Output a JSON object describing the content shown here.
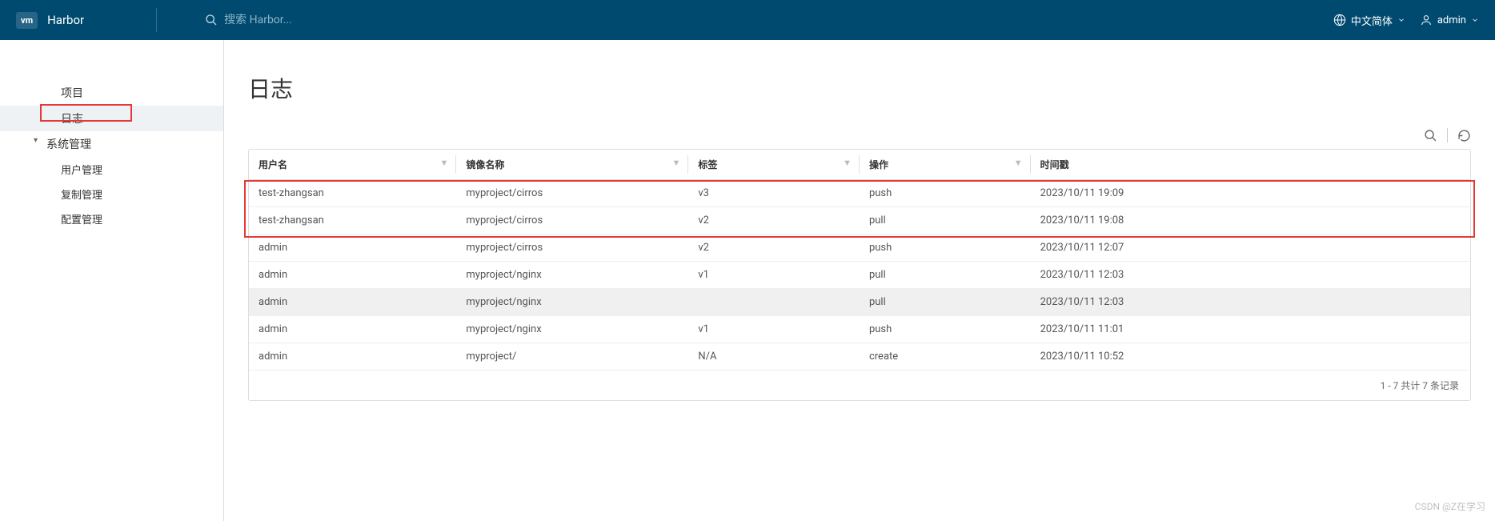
{
  "header": {
    "logo": "vm",
    "app_name": "Harbor",
    "search_placeholder": "搜索 Harbor...",
    "language": "中文简体",
    "user": "admin"
  },
  "sidebar": {
    "items": [
      {
        "label": "项目",
        "type": "item"
      },
      {
        "label": "日志",
        "type": "item",
        "active": true
      },
      {
        "label": "系统管理",
        "type": "group"
      },
      {
        "label": "用户管理",
        "type": "sub"
      },
      {
        "label": "复制管理",
        "type": "sub"
      },
      {
        "label": "配置管理",
        "type": "sub"
      }
    ]
  },
  "page": {
    "title": "日志"
  },
  "table": {
    "columns": [
      "用户名",
      "镜像名称",
      "标签",
      "操作",
      "时间戳"
    ],
    "rows": [
      {
        "user": "test-zhangsan",
        "image": "myproject/cirros",
        "tag": "v3",
        "op": "push",
        "time": "2023/10/11 19:09"
      },
      {
        "user": "test-zhangsan",
        "image": "myproject/cirros",
        "tag": "v2",
        "op": "pull",
        "time": "2023/10/11 19:08"
      },
      {
        "user": "admin",
        "image": "myproject/cirros",
        "tag": "v2",
        "op": "push",
        "time": "2023/10/11 12:07"
      },
      {
        "user": "admin",
        "image": "myproject/nginx",
        "tag": "v1",
        "op": "pull",
        "time": "2023/10/11 12:03"
      },
      {
        "user": "admin",
        "image": "myproject/nginx",
        "tag": "",
        "op": "pull",
        "time": "2023/10/11 12:03"
      },
      {
        "user": "admin",
        "image": "myproject/nginx",
        "tag": "v1",
        "op": "push",
        "time": "2023/10/11 11:01"
      },
      {
        "user": "admin",
        "image": "myproject/",
        "tag": "N/A",
        "op": "create",
        "time": "2023/10/11 10:52"
      }
    ],
    "footer": "1 - 7 共计 7 条记录"
  },
  "watermark": "CSDN @Z在学习"
}
